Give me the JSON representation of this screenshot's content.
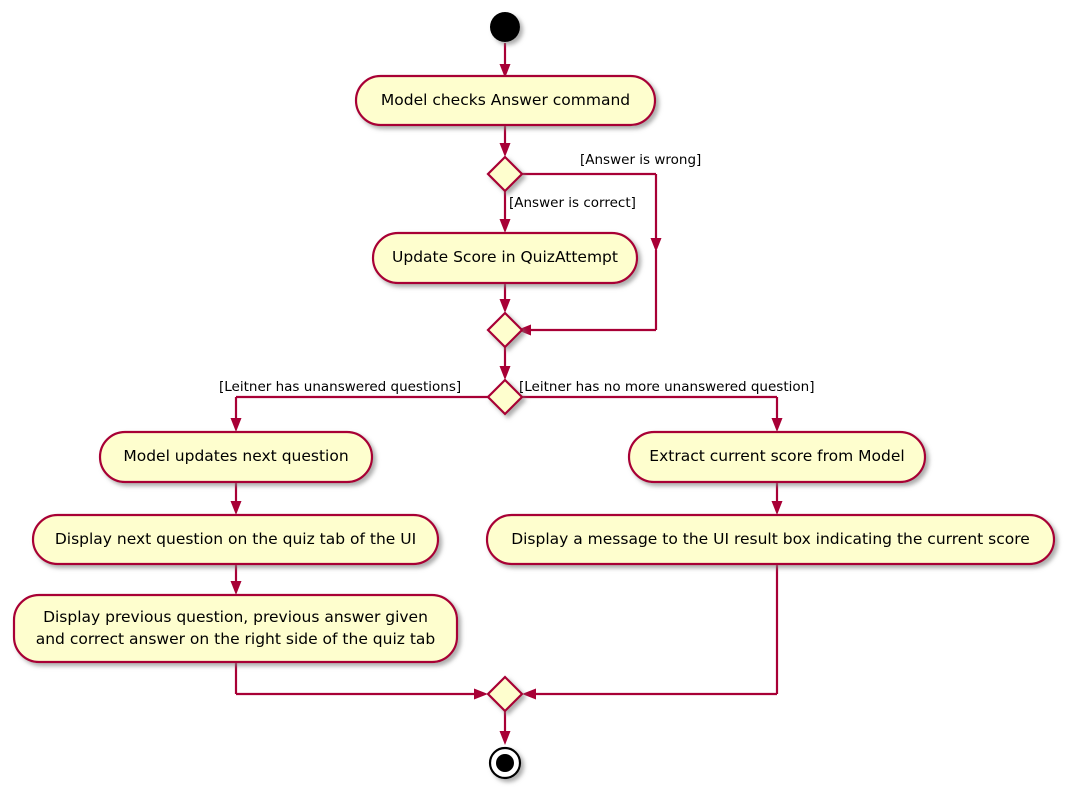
{
  "diagram": {
    "type": "activity-diagram",
    "title": "",
    "colors": {
      "node_fill": "#FEFECE",
      "node_border": "#A80036",
      "edge": "#A80036",
      "text": "#000000",
      "start_node": "#000000",
      "end_node_outer": "#FFFFFF",
      "end_node_inner": "#000000",
      "background": "#FFFFFF",
      "shadow": "#808080"
    },
    "nodes": {
      "start": {
        "shape": "filled-circle",
        "label": ""
      },
      "activity_check": {
        "shape": "rounded-rect",
        "label": "Model checks Answer command"
      },
      "decision_answer": {
        "shape": "diamond",
        "label": ""
      },
      "activity_update_score": {
        "shape": "rounded-rect",
        "label": "Update Score in QuizAttempt"
      },
      "merge_answer": {
        "shape": "diamond",
        "label": ""
      },
      "decision_leitner": {
        "shape": "diamond",
        "label": ""
      },
      "activity_next_question": {
        "shape": "rounded-rect",
        "label": "Model updates next question"
      },
      "activity_display_next": {
        "shape": "rounded-rect",
        "label": "Display next question on the quiz tab of the UI"
      },
      "activity_display_prev": {
        "shape": "rounded-rect",
        "label": "Display previous question, previous answer given\nand correct answer on the right side of the quiz tab"
      },
      "activity_extract_score": {
        "shape": "rounded-rect",
        "label": "Extract current score from Model"
      },
      "activity_display_message": {
        "shape": "rounded-rect",
        "label": "Display a message to the UI result box indicating the current score"
      },
      "merge_final": {
        "shape": "diamond",
        "label": ""
      },
      "end": {
        "shape": "bullseye-circle",
        "label": ""
      }
    },
    "edge_labels": {
      "answer_wrong": "[Answer is wrong]",
      "answer_correct": "[Answer is correct]",
      "leitner_has_questions": "[Leitner has unanswered questions]",
      "leitner_no_questions": "[Leitner has no more unanswered question]"
    }
  }
}
